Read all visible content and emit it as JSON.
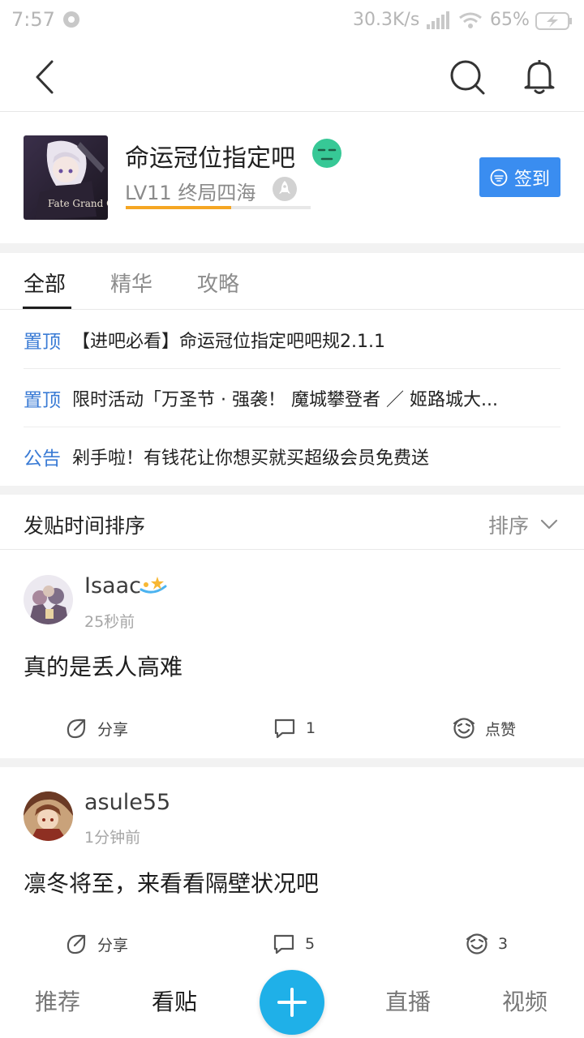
{
  "status_bar": {
    "time": "7:57",
    "network_speed": "30.3K/s",
    "battery_percent": "65%"
  },
  "forum": {
    "name": "命运冠位指定吧",
    "level": "LV11 终局四海",
    "level_progress": 0.57,
    "sign_in_label": "签到",
    "avatar_text": "Fate Grand Order"
  },
  "tabs": [
    {
      "label": "全部",
      "active": true
    },
    {
      "label": "精华",
      "active": false
    },
    {
      "label": "攻略",
      "active": false
    }
  ],
  "pinned": [
    {
      "tag": "置顶",
      "text": "【进吧必看】命运冠位指定吧吧规2.1.1"
    },
    {
      "tag": "置顶",
      "text": "限时活动「万圣节 · 强袭！ 魔城攀登者 ／ 姬路城大..."
    },
    {
      "tag": "公告",
      "text": "剁手啦！有钱花让你想买就买超级会员免费送"
    }
  ],
  "sort_bar": {
    "title": "发贴时间排序",
    "sort_label": "排序"
  },
  "posts": [
    {
      "author": "Isaac",
      "time": "25秒前",
      "text": "真的是丢人高难",
      "share_label": "分享",
      "comments": "1",
      "likes": "点赞"
    },
    {
      "author": "asule55",
      "time": "1分钟前",
      "text": "凛冬将至，来看看隔壁状况吧",
      "share_label": "分享",
      "comments": "5",
      "likes": "3"
    }
  ],
  "bottom_nav": {
    "items": [
      "推荐",
      "看贴",
      "直播",
      "视频"
    ],
    "active": "看贴"
  },
  "colors": {
    "accent_blue": "#3a8df0",
    "tag_blue": "#3a7bd5",
    "level_orange": "#f5a623",
    "post_button": "#1fb0e8"
  }
}
